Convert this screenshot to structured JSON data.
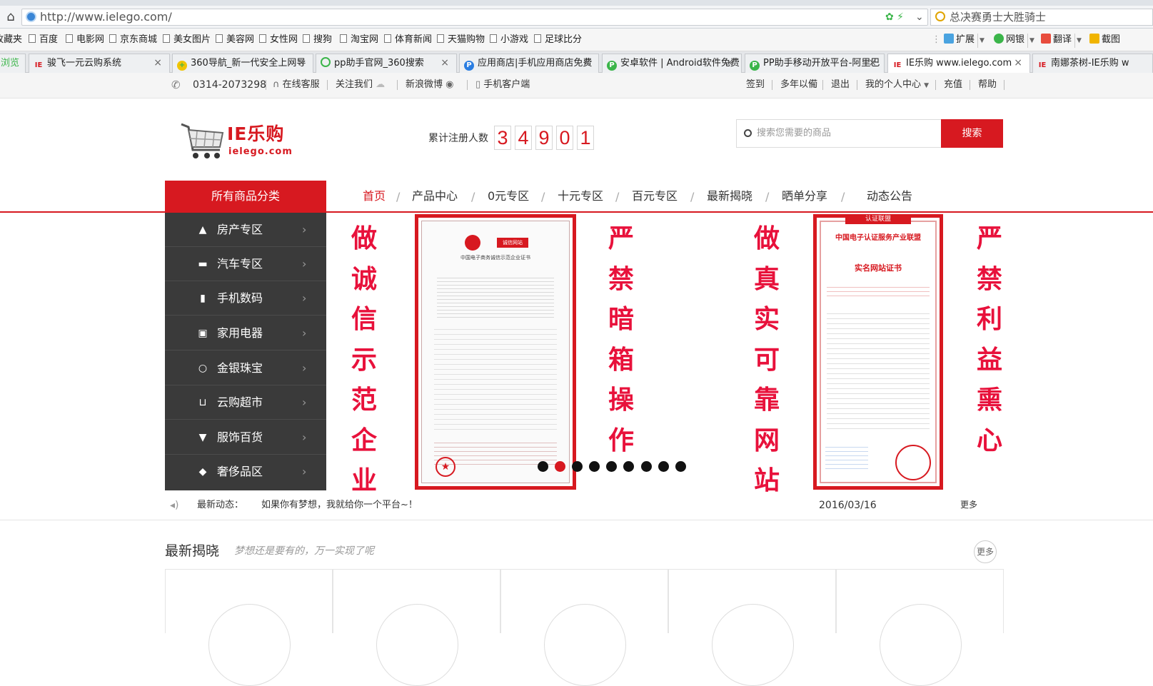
{
  "browser": {
    "url": "http://www.ielego.com/",
    "search_text": "总决赛勇士大胜骑士",
    "bookmarks": [
      "收藏夹",
      "百度",
      "电影网",
      "京东商城",
      "美女图片",
      "美容网",
      "女性网",
      "搜狗",
      "淘宝网",
      "体育新闻",
      "天猫购物",
      "小游戏",
      "足球比分"
    ],
    "tools": {
      "ext": "扩展",
      "bank": "网银",
      "translate": "翻译",
      "screenshot": "截图"
    },
    "tabs": [
      "浏览",
      "骏飞一元云购系统",
      "360导航_新一代安全上网导",
      "pp助手官网_360搜索",
      "应用商店|手机应用商店免费",
      "安卓软件 | Android软件免费",
      "PP助手移动开放平台-阿里巴",
      "IE乐购 www.ielego.com",
      "南娜茶树-IE乐购 w"
    ]
  },
  "topbar": {
    "phone": "0314-2073298",
    "service": "在线客服",
    "follow": "关注我们",
    "weibo": "新浪微博",
    "mobile": "手机客户端",
    "links": [
      "签到",
      "多年以僃",
      "退出",
      "我的个人中心",
      "充值",
      "帮助"
    ]
  },
  "header": {
    "logo_main": "IE乐购",
    "logo_sub": "ielego.com",
    "reg_label": "累计注册人数",
    "reg_digits": [
      "3",
      "4",
      "9",
      "0",
      "1"
    ],
    "search_placeholder": "搜索您需要的商品",
    "search_button": "搜索"
  },
  "nav": {
    "category_button": "所有商品分类",
    "items": [
      "首页",
      "产品中心",
      "0元专区",
      "十元专区",
      "百元专区",
      "最新揭晓",
      "晒单分享",
      "动态公告"
    ],
    "separator": "/"
  },
  "sidebar": {
    "items": [
      {
        "label": "房产专区",
        "icon": "building-icon"
      },
      {
        "label": "汽车专区",
        "icon": "car-icon"
      },
      {
        "label": "手机数码",
        "icon": "phone-icon"
      },
      {
        "label": "家用电器",
        "icon": "tv-icon"
      },
      {
        "label": "金银珠宝",
        "icon": "ring-icon"
      },
      {
        "label": "云购超市",
        "icon": "cart-icon"
      },
      {
        "label": "服饰百货",
        "icon": "shirt-icon"
      },
      {
        "label": "奢侈品区",
        "icon": "diamond-icon"
      }
    ]
  },
  "banner": {
    "col1": [
      "做",
      "诚",
      "信",
      "示",
      "范",
      "企",
      "业"
    ],
    "col2": [
      "严",
      "禁",
      "暗",
      "箱",
      "操",
      "作"
    ],
    "col3": [
      "做",
      "真",
      "实",
      "可",
      "靠",
      "网",
      "站"
    ],
    "col4": [
      "严",
      "禁",
      "利",
      "益",
      "熏",
      "心"
    ],
    "cert1": {
      "badge": "诚信网站",
      "title": "中国电子商务诚信示范企业证书"
    },
    "cert2": {
      "header": "认证联盟",
      "title": "中国电子认证服务产业联盟",
      "subtitle": "实名网站证书"
    },
    "dots_total": 9,
    "dots_active_index": 1
  },
  "news": {
    "label": "最新动态：",
    "text": "如果你有梦想，我就给你一个平台~！",
    "date": "2016/03/16",
    "more": "更多"
  },
  "latest": {
    "title": "最新揭晓",
    "subtitle": "梦想还是要有的，万一实现了呢",
    "more": "更多"
  },
  "colors": {
    "brand_red": "#d71920",
    "sidebar_bg": "#3a3a3a",
    "banner_text": "#e8113b"
  }
}
